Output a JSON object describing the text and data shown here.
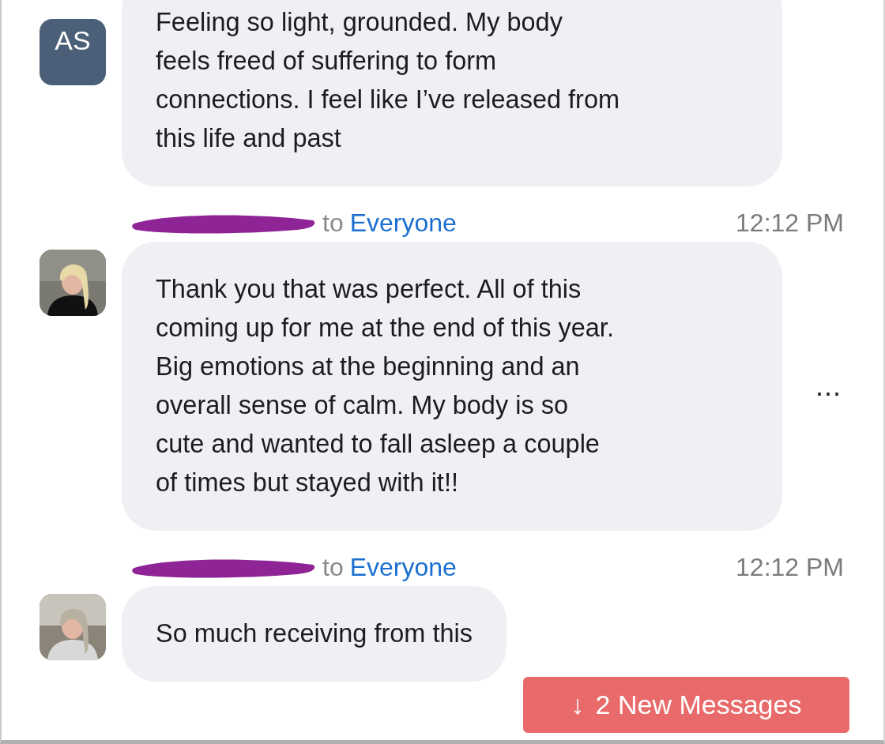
{
  "messages": [
    {
      "avatar": {
        "kind": "initials",
        "text": "AS"
      },
      "lines": [
        "Feeling so light, grounded. My body",
        "feels freed of suffering to form",
        "connections. I feel like I’ve released from",
        "this life and past"
      ]
    },
    {
      "header": {
        "to": "to",
        "recipient": "Everyone",
        "time": "12:12 PM"
      },
      "lines": [
        "Thank you that was perfect. All of this",
        "coming up for me at the end of this year.",
        "Big emotions at the beginning and an",
        "overall sense of calm. My body is so",
        "cute and wanted to fall asleep a couple",
        "of times but stayed with it!!"
      ],
      "more_text": "..."
    },
    {
      "header": {
        "to": "to",
        "recipient": "Everyone",
        "time": "12:12 PM"
      },
      "lines": [
        "So much receiving from this"
      ]
    }
  ],
  "new_messages": {
    "arrow": "↓",
    "label": "2 New Messages"
  }
}
